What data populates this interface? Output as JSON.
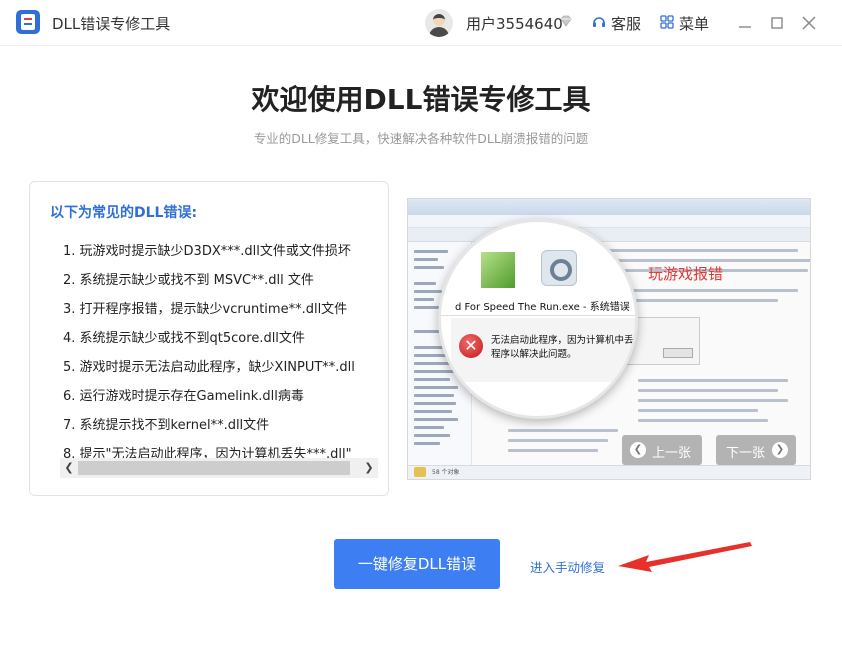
{
  "app": {
    "title": "DLL错误专修工具",
    "user_name": "用户3554640",
    "service_label": "客服",
    "menu_label": "菜单"
  },
  "header": {
    "title": "欢迎使用DLL错误专修工具",
    "subtitle": "专业的DLL修复工具，快速解决各种软件DLL崩溃报错的问题"
  },
  "error_panel": {
    "heading": "以下为常见的DLL错误:",
    "items": [
      "1. 玩游戏时提示缺少D3DX***.dll文件或文件损坏",
      "2. 系统提示缺少或找不到 MSVC**.dll 文件",
      "3. 打开程序报错，提示缺少vcruntime**.dll文件",
      "4. 系统提示缺少或找不到qt5core.dll文件",
      "5. 游戏时提示无法启动此程序，缺少XINPUT**.dll",
      "6. 运行游戏时提示存在Gamelink.dll病毒",
      "7. 系统提示找不到kernel**.dll文件",
      "8. 提示\"无法启动此程序，因为计算机丢失***.dll\""
    ]
  },
  "carousel": {
    "caption": "玩游戏报错",
    "dialog_title": "d For Speed The Run.exe - 系统错误",
    "dialog_line1": "无法启动此程序，因为计算机中丢",
    "dialog_line2": "程序以解决此问题。",
    "prev_label": "上一张",
    "next_label": "下一张",
    "status_text": "58 个对象"
  },
  "actions": {
    "fix_label": "一键修复DLL错误",
    "manual_label": "进入手动修复"
  },
  "colors": {
    "accent": "#3d7ff2",
    "link": "#2f6fd6",
    "caption_red": "#e53935",
    "arrow_red": "#e8302a"
  }
}
